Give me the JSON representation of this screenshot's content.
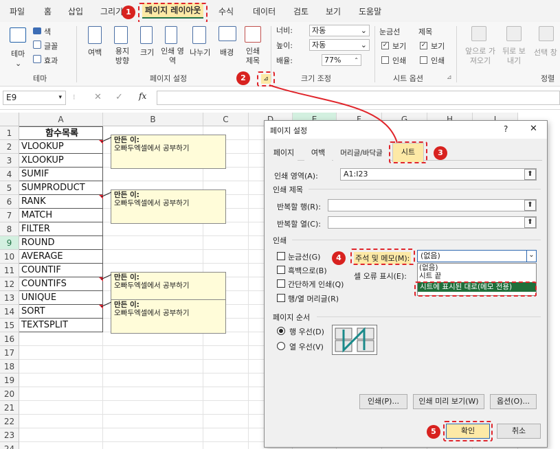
{
  "ribbon_tabs": [
    "파일",
    "홈",
    "삽입",
    "그리기",
    "페이지 레이아웃",
    "수식",
    "데이터",
    "검토",
    "보기",
    "도움말"
  ],
  "ribbon": {
    "theme": {
      "themes": "테마",
      "colors": "색",
      "fonts": "글꼴",
      "effects": "효과",
      "group": "테마"
    },
    "page_setup": {
      "margins": "여백",
      "orientation": "용지 방향",
      "size": "크기",
      "print_area": "인쇄 영역",
      "breaks": "나누기",
      "background": "배경",
      "print_titles": "인쇄 제목",
      "group": "페이지 설정"
    },
    "scale": {
      "width_label": "너비:",
      "width_value": "자동",
      "height_label": "높이:",
      "height_value": "자동",
      "scale_label": "배율:",
      "scale_value": "77%",
      "group": "크기 조정"
    },
    "sheet_options": {
      "gridlines": "눈금선",
      "headings": "제목",
      "view": "보기",
      "print": "인쇄",
      "group": "시트 옵션"
    },
    "arrange": {
      "bring_forward": "앞으로 가져오기",
      "send_backward": "뒤로 보내기",
      "selection": "선택 창",
      "group": "정렬"
    }
  },
  "formula_bar": {
    "name_box": "E9",
    "fx": "fx",
    "formula": ""
  },
  "grid": {
    "columns": [
      "A",
      "B",
      "C",
      "D",
      "E",
      "F",
      "G",
      "H",
      "I"
    ],
    "rows": [
      "1",
      "2",
      "3",
      "4",
      "5",
      "6",
      "7",
      "8",
      "9",
      "10",
      "11",
      "12",
      "13",
      "14",
      "15",
      "16",
      "17",
      "18",
      "19",
      "20",
      "21",
      "22",
      "23",
      "24"
    ],
    "col_a": [
      "함수목록",
      "VLOOKUP",
      "XLOOKUP",
      "SUMIF",
      "SUMPRODUCT",
      "RANK",
      "MATCH",
      "FILTER",
      "ROUND",
      "AVERAGE",
      "COUNTIF",
      "COUNTIFS",
      "UNIQUE",
      "SORT",
      "TEXTSPLIT"
    ],
    "notes": [
      {
        "author": "만든 이:",
        "text": "오빠두엑셀에서 공부하기"
      },
      {
        "author": "만든 이:",
        "text": "오빠두엑셀에서 공부하기"
      },
      {
        "author": "만든 이:",
        "text": "오빠두엑셀에서 공부하기"
      },
      {
        "author": "만든 이:",
        "text": "오빠두엑셀에서 공부하기"
      }
    ]
  },
  "dialog": {
    "title": "페이지 설정",
    "help": "?",
    "close": "✕",
    "tabs": [
      "페이지",
      "여백",
      "머리글/바닥글",
      "시트"
    ],
    "print_area_label": "인쇄 영역(A):",
    "print_area_value": "A1:I23",
    "print_titles_section": "인쇄 제목",
    "rows_repeat_label": "반복할 행(R):",
    "cols_repeat_label": "반복할 열(C):",
    "print_section": "인쇄",
    "gridlines": "눈금선(G)",
    "black_white": "흑백으로(B)",
    "draft": "간단하게 인쇄(Q)",
    "row_col_headings": "행/열 머리글(R)",
    "comments_label": "주석 및 메모(M):",
    "comments_value": "(없음)",
    "comments_options": [
      "(없음)",
      "시트 끝",
      "시트에 표시된 대로(메모 전용)"
    ],
    "cell_errors_label": "셀 오류 표시(E):",
    "page_order_section": "페이지 순서",
    "down_then_over": "행 우선(D)",
    "over_then_down": "열 우선(V)",
    "print_btn": "인쇄(P)...",
    "preview_btn": "인쇄 미리 보기(W)",
    "options_btn": "옵션(O)...",
    "ok_btn": "확인",
    "cancel_btn": "취소"
  },
  "badges": [
    "1",
    "2",
    "3",
    "4",
    "5"
  ],
  "colors": {
    "accent": "#e0252b",
    "highlight": "#fde9a6",
    "excel_green": "#217346",
    "selected_option": "#1f6f3a"
  }
}
